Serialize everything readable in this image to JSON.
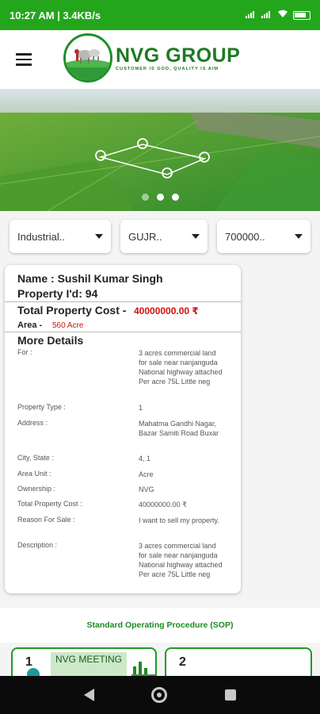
{
  "status_bar": {
    "time": "10:27 AM | 3.4KB/s",
    "battery": "64"
  },
  "app": {
    "logo_title": "NVG GROUP",
    "logo_tagline": "CUSTOMER IS GOD, QUALITY IS AIM",
    "menu_icon": "hamburger-menu-icon"
  },
  "banner": {
    "slides": 3,
    "active_slide": 2
  },
  "filters": {
    "type": "Industrial..",
    "state": "GUJR..",
    "price": "700000.."
  },
  "property": {
    "name": "Name : Sushil Kumar Singh",
    "property_id": "Property I'd: 94",
    "total_cost_label": "Total Property Cost -",
    "total_cost_value": "40000000.00 ₹",
    "area_label": "Area -",
    "area_value": "560 Acre",
    "more_details": "More Details",
    "details": [
      {
        "key": "For :",
        "value": "3 acres commercial land for sale near nanjanguda National highway attached Per acre 75L Little neg"
      },
      {
        "key": "Property Type :",
        "value": "1"
      },
      {
        "key": "Address :",
        "value": "Mahatma Gandhi Nagar, Bazar Samiti Road Buxar"
      },
      {
        "key": "City, State :",
        "value": "4, 1"
      },
      {
        "key": "Area Unit :",
        "value": "Acre"
      },
      {
        "key": "Ownership :",
        "value": "NVG"
      },
      {
        "key": "Total Property Cost :",
        "value": "40000000.00 ₹"
      },
      {
        "key": "Reason For Sale :",
        "value": "I want to sell my property."
      },
      {
        "key": "Description :",
        "value": "3 acres commercial land for sale near nanjanguda National highway attached Per acre 75L Little neg"
      }
    ]
  },
  "sop": {
    "title": "Standard Operating Procedure (SOP)",
    "steps": [
      {
        "number": "1",
        "label": "NVG MEETING"
      },
      {
        "number": "2",
        "label": ""
      }
    ]
  },
  "colors": {
    "brand_green": "#24a61c",
    "logo_green": "#1d7a22",
    "price_red": "#d01010"
  }
}
